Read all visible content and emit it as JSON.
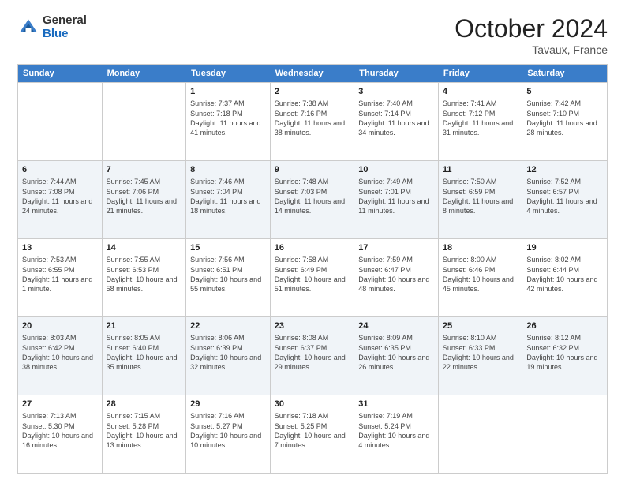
{
  "header": {
    "logo_general": "General",
    "logo_blue": "Blue",
    "month_title": "October 2024",
    "location": "Tavaux, France"
  },
  "weekdays": [
    "Sunday",
    "Monday",
    "Tuesday",
    "Wednesday",
    "Thursday",
    "Friday",
    "Saturday"
  ],
  "rows": [
    [
      {
        "day": "",
        "info": ""
      },
      {
        "day": "",
        "info": ""
      },
      {
        "day": "1",
        "info": "Sunrise: 7:37 AM\nSunset: 7:18 PM\nDaylight: 11 hours and 41 minutes."
      },
      {
        "day": "2",
        "info": "Sunrise: 7:38 AM\nSunset: 7:16 PM\nDaylight: 11 hours and 38 minutes."
      },
      {
        "day": "3",
        "info": "Sunrise: 7:40 AM\nSunset: 7:14 PM\nDaylight: 11 hours and 34 minutes."
      },
      {
        "day": "4",
        "info": "Sunrise: 7:41 AM\nSunset: 7:12 PM\nDaylight: 11 hours and 31 minutes."
      },
      {
        "day": "5",
        "info": "Sunrise: 7:42 AM\nSunset: 7:10 PM\nDaylight: 11 hours and 28 minutes."
      }
    ],
    [
      {
        "day": "6",
        "info": "Sunrise: 7:44 AM\nSunset: 7:08 PM\nDaylight: 11 hours and 24 minutes."
      },
      {
        "day": "7",
        "info": "Sunrise: 7:45 AM\nSunset: 7:06 PM\nDaylight: 11 hours and 21 minutes."
      },
      {
        "day": "8",
        "info": "Sunrise: 7:46 AM\nSunset: 7:04 PM\nDaylight: 11 hours and 18 minutes."
      },
      {
        "day": "9",
        "info": "Sunrise: 7:48 AM\nSunset: 7:03 PM\nDaylight: 11 hours and 14 minutes."
      },
      {
        "day": "10",
        "info": "Sunrise: 7:49 AM\nSunset: 7:01 PM\nDaylight: 11 hours and 11 minutes."
      },
      {
        "day": "11",
        "info": "Sunrise: 7:50 AM\nSunset: 6:59 PM\nDaylight: 11 hours and 8 minutes."
      },
      {
        "day": "12",
        "info": "Sunrise: 7:52 AM\nSunset: 6:57 PM\nDaylight: 11 hours and 4 minutes."
      }
    ],
    [
      {
        "day": "13",
        "info": "Sunrise: 7:53 AM\nSunset: 6:55 PM\nDaylight: 11 hours and 1 minute."
      },
      {
        "day": "14",
        "info": "Sunrise: 7:55 AM\nSunset: 6:53 PM\nDaylight: 10 hours and 58 minutes."
      },
      {
        "day": "15",
        "info": "Sunrise: 7:56 AM\nSunset: 6:51 PM\nDaylight: 10 hours and 55 minutes."
      },
      {
        "day": "16",
        "info": "Sunrise: 7:58 AM\nSunset: 6:49 PM\nDaylight: 10 hours and 51 minutes."
      },
      {
        "day": "17",
        "info": "Sunrise: 7:59 AM\nSunset: 6:47 PM\nDaylight: 10 hours and 48 minutes."
      },
      {
        "day": "18",
        "info": "Sunrise: 8:00 AM\nSunset: 6:46 PM\nDaylight: 10 hours and 45 minutes."
      },
      {
        "day": "19",
        "info": "Sunrise: 8:02 AM\nSunset: 6:44 PM\nDaylight: 10 hours and 42 minutes."
      }
    ],
    [
      {
        "day": "20",
        "info": "Sunrise: 8:03 AM\nSunset: 6:42 PM\nDaylight: 10 hours and 38 minutes."
      },
      {
        "day": "21",
        "info": "Sunrise: 8:05 AM\nSunset: 6:40 PM\nDaylight: 10 hours and 35 minutes."
      },
      {
        "day": "22",
        "info": "Sunrise: 8:06 AM\nSunset: 6:39 PM\nDaylight: 10 hours and 32 minutes."
      },
      {
        "day": "23",
        "info": "Sunrise: 8:08 AM\nSunset: 6:37 PM\nDaylight: 10 hours and 29 minutes."
      },
      {
        "day": "24",
        "info": "Sunrise: 8:09 AM\nSunset: 6:35 PM\nDaylight: 10 hours and 26 minutes."
      },
      {
        "day": "25",
        "info": "Sunrise: 8:10 AM\nSunset: 6:33 PM\nDaylight: 10 hours and 22 minutes."
      },
      {
        "day": "26",
        "info": "Sunrise: 8:12 AM\nSunset: 6:32 PM\nDaylight: 10 hours and 19 minutes."
      }
    ],
    [
      {
        "day": "27",
        "info": "Sunrise: 7:13 AM\nSunset: 5:30 PM\nDaylight: 10 hours and 16 minutes."
      },
      {
        "day": "28",
        "info": "Sunrise: 7:15 AM\nSunset: 5:28 PM\nDaylight: 10 hours and 13 minutes."
      },
      {
        "day": "29",
        "info": "Sunrise: 7:16 AM\nSunset: 5:27 PM\nDaylight: 10 hours and 10 minutes."
      },
      {
        "day": "30",
        "info": "Sunrise: 7:18 AM\nSunset: 5:25 PM\nDaylight: 10 hours and 7 minutes."
      },
      {
        "day": "31",
        "info": "Sunrise: 7:19 AM\nSunset: 5:24 PM\nDaylight: 10 hours and 4 minutes."
      },
      {
        "day": "",
        "info": ""
      },
      {
        "day": "",
        "info": ""
      }
    ]
  ]
}
